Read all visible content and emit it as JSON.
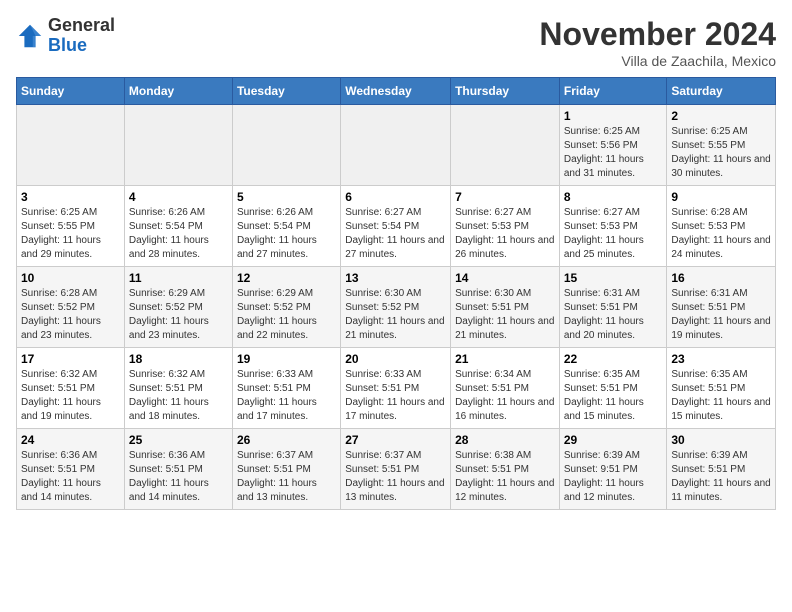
{
  "logo": {
    "general": "General",
    "blue": "Blue"
  },
  "header": {
    "month": "November 2024",
    "location": "Villa de Zaachila, Mexico"
  },
  "weekdays": [
    "Sunday",
    "Monday",
    "Tuesday",
    "Wednesday",
    "Thursday",
    "Friday",
    "Saturday"
  ],
  "weeks": [
    [
      {
        "day": "",
        "info": ""
      },
      {
        "day": "",
        "info": ""
      },
      {
        "day": "",
        "info": ""
      },
      {
        "day": "",
        "info": ""
      },
      {
        "day": "",
        "info": ""
      },
      {
        "day": "1",
        "info": "Sunrise: 6:25 AM\nSunset: 5:56 PM\nDaylight: 11 hours and 31 minutes."
      },
      {
        "day": "2",
        "info": "Sunrise: 6:25 AM\nSunset: 5:55 PM\nDaylight: 11 hours and 30 minutes."
      }
    ],
    [
      {
        "day": "3",
        "info": "Sunrise: 6:25 AM\nSunset: 5:55 PM\nDaylight: 11 hours and 29 minutes."
      },
      {
        "day": "4",
        "info": "Sunrise: 6:26 AM\nSunset: 5:54 PM\nDaylight: 11 hours and 28 minutes."
      },
      {
        "day": "5",
        "info": "Sunrise: 6:26 AM\nSunset: 5:54 PM\nDaylight: 11 hours and 27 minutes."
      },
      {
        "day": "6",
        "info": "Sunrise: 6:27 AM\nSunset: 5:54 PM\nDaylight: 11 hours and 27 minutes."
      },
      {
        "day": "7",
        "info": "Sunrise: 6:27 AM\nSunset: 5:53 PM\nDaylight: 11 hours and 26 minutes."
      },
      {
        "day": "8",
        "info": "Sunrise: 6:27 AM\nSunset: 5:53 PM\nDaylight: 11 hours and 25 minutes."
      },
      {
        "day": "9",
        "info": "Sunrise: 6:28 AM\nSunset: 5:53 PM\nDaylight: 11 hours and 24 minutes."
      }
    ],
    [
      {
        "day": "10",
        "info": "Sunrise: 6:28 AM\nSunset: 5:52 PM\nDaylight: 11 hours and 23 minutes."
      },
      {
        "day": "11",
        "info": "Sunrise: 6:29 AM\nSunset: 5:52 PM\nDaylight: 11 hours and 23 minutes."
      },
      {
        "day": "12",
        "info": "Sunrise: 6:29 AM\nSunset: 5:52 PM\nDaylight: 11 hours and 22 minutes."
      },
      {
        "day": "13",
        "info": "Sunrise: 6:30 AM\nSunset: 5:52 PM\nDaylight: 11 hours and 21 minutes."
      },
      {
        "day": "14",
        "info": "Sunrise: 6:30 AM\nSunset: 5:51 PM\nDaylight: 11 hours and 21 minutes."
      },
      {
        "day": "15",
        "info": "Sunrise: 6:31 AM\nSunset: 5:51 PM\nDaylight: 11 hours and 20 minutes."
      },
      {
        "day": "16",
        "info": "Sunrise: 6:31 AM\nSunset: 5:51 PM\nDaylight: 11 hours and 19 minutes."
      }
    ],
    [
      {
        "day": "17",
        "info": "Sunrise: 6:32 AM\nSunset: 5:51 PM\nDaylight: 11 hours and 19 minutes."
      },
      {
        "day": "18",
        "info": "Sunrise: 6:32 AM\nSunset: 5:51 PM\nDaylight: 11 hours and 18 minutes."
      },
      {
        "day": "19",
        "info": "Sunrise: 6:33 AM\nSunset: 5:51 PM\nDaylight: 11 hours and 17 minutes."
      },
      {
        "day": "20",
        "info": "Sunrise: 6:33 AM\nSunset: 5:51 PM\nDaylight: 11 hours and 17 minutes."
      },
      {
        "day": "21",
        "info": "Sunrise: 6:34 AM\nSunset: 5:51 PM\nDaylight: 11 hours and 16 minutes."
      },
      {
        "day": "22",
        "info": "Sunrise: 6:35 AM\nSunset: 5:51 PM\nDaylight: 11 hours and 15 minutes."
      },
      {
        "day": "23",
        "info": "Sunrise: 6:35 AM\nSunset: 5:51 PM\nDaylight: 11 hours and 15 minutes."
      }
    ],
    [
      {
        "day": "24",
        "info": "Sunrise: 6:36 AM\nSunset: 5:51 PM\nDaylight: 11 hours and 14 minutes."
      },
      {
        "day": "25",
        "info": "Sunrise: 6:36 AM\nSunset: 5:51 PM\nDaylight: 11 hours and 14 minutes."
      },
      {
        "day": "26",
        "info": "Sunrise: 6:37 AM\nSunset: 5:51 PM\nDaylight: 11 hours and 13 minutes."
      },
      {
        "day": "27",
        "info": "Sunrise: 6:37 AM\nSunset: 5:51 PM\nDaylight: 11 hours and 13 minutes."
      },
      {
        "day": "28",
        "info": "Sunrise: 6:38 AM\nSunset: 5:51 PM\nDaylight: 11 hours and 12 minutes."
      },
      {
        "day": "29",
        "info": "Sunrise: 6:39 AM\nSunset: 9:51 PM\nDaylight: 11 hours and 12 minutes."
      },
      {
        "day": "30",
        "info": "Sunrise: 6:39 AM\nSunset: 5:51 PM\nDaylight: 11 hours and 11 minutes."
      }
    ]
  ]
}
